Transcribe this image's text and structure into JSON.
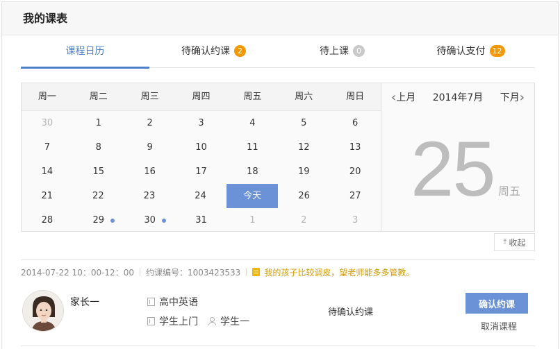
{
  "header": {
    "title": "我的课表"
  },
  "tabs": [
    {
      "label": "课程日历",
      "badge": "",
      "active": true
    },
    {
      "label": "待确认约课",
      "badge": "2",
      "badge_color": "#f39800"
    },
    {
      "label": "待上课",
      "badge": "0",
      "badge_color": "#c9c9c9"
    },
    {
      "label": "待确认支付",
      "badge": "12",
      "badge_color": "#f39800"
    }
  ],
  "calendar": {
    "weekdays": [
      "周一",
      "周二",
      "周三",
      "周四",
      "周五",
      "周六",
      "周日"
    ],
    "rows": [
      [
        "30",
        "1",
        "2",
        "3",
        "4",
        "5",
        "6"
      ],
      [
        "7",
        "8",
        "9",
        "10",
        "11",
        "12",
        "13"
      ],
      [
        "14",
        "15",
        "16",
        "17",
        "18",
        "19",
        "20"
      ],
      [
        "21",
        "22",
        "23",
        "24",
        "今天",
        "26",
        "27"
      ],
      [
        "28",
        "29",
        "30",
        "31",
        "1",
        "2",
        "3"
      ]
    ],
    "prev_label": "上月",
    "month_label": "2014年7月",
    "next_label": "下月",
    "big_day": "25",
    "big_weekday": "周五",
    "collapse_label": "收起",
    "accent": "#6b92d6"
  },
  "order": {
    "time": "2014-07-22 10：00-12：00",
    "number": "约课编号：1003423533",
    "note": "我的孩子比较调皮，望老师能多多管教。",
    "parent_name": "家长一",
    "subject": "高中英语",
    "mode": "学生上门",
    "student": "学生一",
    "status": "待确认约课",
    "confirm_label": "确认约课",
    "cancel_label": "取消课程"
  }
}
